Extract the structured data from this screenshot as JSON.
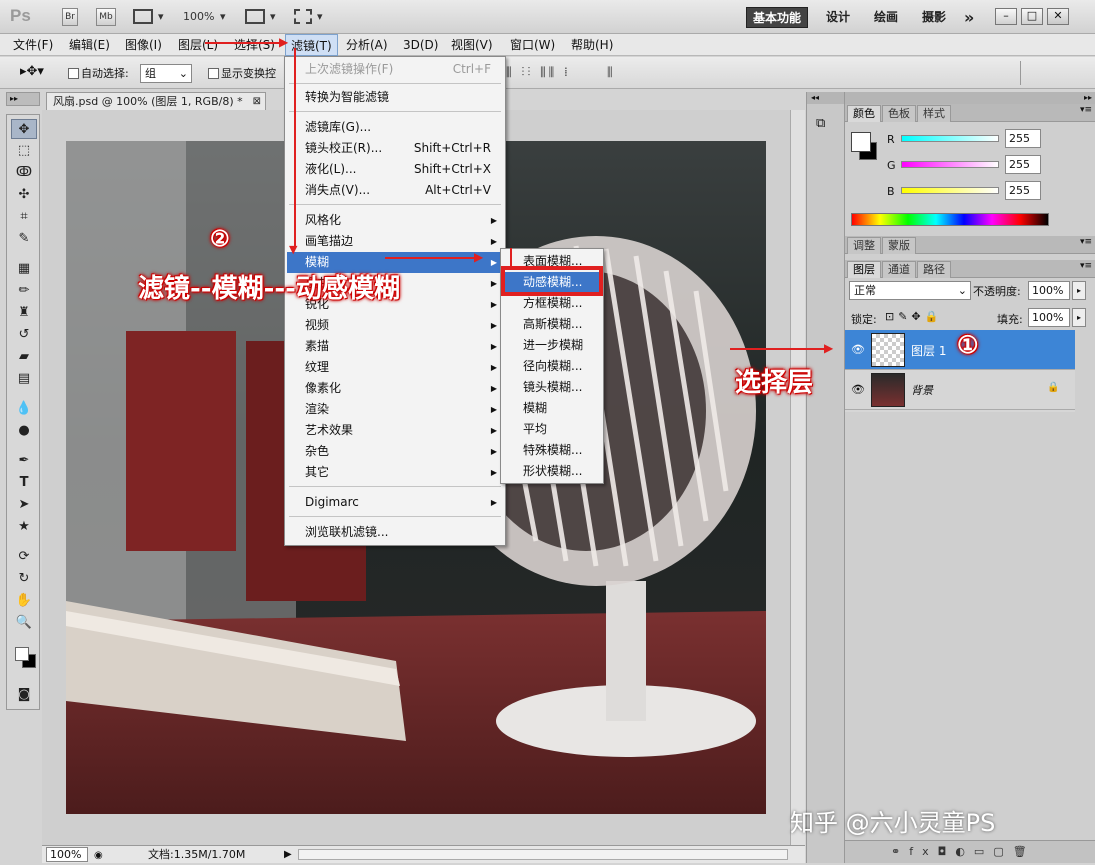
{
  "app": {
    "logo": "Ps",
    "br": "Br",
    "mb": "Mb",
    "zoom": "100%"
  },
  "workspaces": [
    "基本功能",
    "设计",
    "绘画",
    "摄影",
    "»"
  ],
  "menubar": [
    "文件(F)",
    "编辑(E)",
    "图像(I)",
    "图层(L)",
    "选择(S)",
    "滤镜(T)",
    "分析(A)",
    "3D(D)",
    "视图(V)",
    "窗口(W)",
    "帮助(H)"
  ],
  "options": {
    "auto_select": "自动选择:",
    "auto_select_value": "组",
    "show_transform": "显示变换控"
  },
  "document": {
    "tab_title": "风扇.psd @ 100% (图层 1, RGB/8) *",
    "status_zoom": "100%",
    "status_doc": "文档:1.35M/1.70M"
  },
  "filter_menu": [
    {
      "label": "上次滤镜操作(F)",
      "shortcut": "Ctrl+F",
      "disabled": true
    },
    {
      "label": "转换为智能滤镜"
    },
    {
      "label": "滤镜库(G)...",
      "shortcut": ""
    },
    {
      "label": "镜头校正(R)...",
      "shortcut": "Shift+Ctrl+R"
    },
    {
      "label": "液化(L)...",
      "shortcut": "Shift+Ctrl+X"
    },
    {
      "label": "消失点(V)...",
      "shortcut": "Alt+Ctrl+V"
    },
    {
      "label": "风格化"
    },
    {
      "label": "画笔描边"
    },
    {
      "label": "模糊"
    },
    {
      "label": "扭曲"
    },
    {
      "label": "锐化"
    },
    {
      "label": "视频"
    },
    {
      "label": "素描"
    },
    {
      "label": "纹理"
    },
    {
      "label": "像素化"
    },
    {
      "label": "渲染"
    },
    {
      "label": "艺术效果"
    },
    {
      "label": "杂色"
    },
    {
      "label": "其它"
    },
    {
      "label": "Digimarc"
    },
    {
      "label": "浏览联机滤镜..."
    }
  ],
  "blur_menu": [
    "表面模糊...",
    "动感模糊...",
    "方框模糊...",
    "高斯模糊...",
    "进一步模糊",
    "径向模糊...",
    "镜头模糊...",
    "模糊",
    "平均",
    "特殊模糊...",
    "形状模糊..."
  ],
  "color_panel": {
    "tabs": [
      "颜色",
      "色板",
      "样式"
    ],
    "r_label": "R",
    "g_label": "G",
    "b_label": "B",
    "r": "255",
    "g": "255",
    "b": "255"
  },
  "adjust_panel": {
    "tabs": [
      "调整",
      "蒙版"
    ]
  },
  "layers_panel": {
    "tabs": [
      "图层",
      "通道",
      "路径"
    ],
    "blend_mode": "正常",
    "opacity_label": "不透明度:",
    "opacity": "100%",
    "lock_label": "锁定:",
    "fill_label": "填充:",
    "fill": "100%",
    "layers": [
      {
        "name": "图层 1",
        "selected": true
      },
      {
        "name": "背景",
        "selected": false
      }
    ]
  },
  "annotations": {
    "step2": "②",
    "step1": "①",
    "instruction": "滤镜--模糊---动感模糊",
    "select_layer": "选择层",
    "watermark": "知乎 @六小灵童PS"
  },
  "colors": {
    "accent": "#3d76c8",
    "annotation": "#e02020",
    "layer_selected": "#3d85d6"
  }
}
